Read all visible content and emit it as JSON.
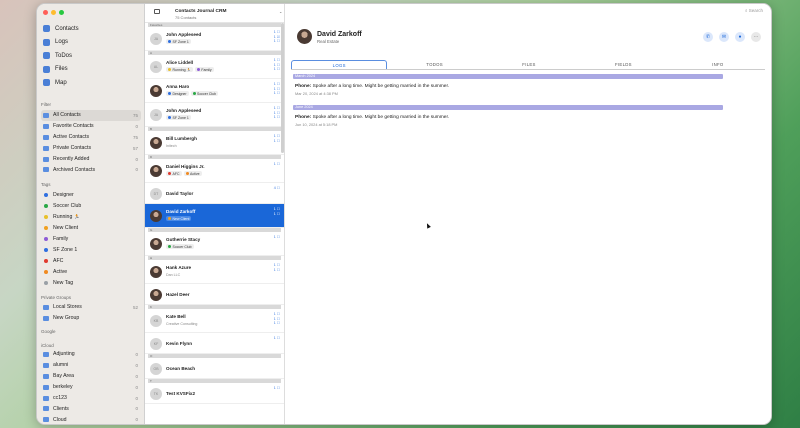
{
  "colors": {
    "accent": "#1a67d8",
    "close": "#ff5f57",
    "minimize": "#febc2e",
    "zoom": "#28c840",
    "month_bar": "#a9a8e3"
  },
  "nav": [
    {
      "label": "Contacts",
      "icon": "person-icon"
    },
    {
      "label": "Logs",
      "icon": "log-icon"
    },
    {
      "label": "ToDos",
      "icon": "todo-icon"
    },
    {
      "label": "Files",
      "icon": "folder-icon"
    },
    {
      "label": "Map",
      "icon": "map-icon"
    }
  ],
  "filter_title": "Filter",
  "filters": [
    {
      "label": "All Contacts",
      "count": "75"
    },
    {
      "label": "Favorite Contacts",
      "count": "0"
    },
    {
      "label": "Active Contacts",
      "count": "75"
    },
    {
      "label": "Private Contacts",
      "count": "57"
    },
    {
      "label": "Recently Added",
      "count": "0"
    },
    {
      "label": "Archived Contacts",
      "count": "0"
    }
  ],
  "tags_title": "Tags",
  "tags": [
    {
      "label": "Designer",
      "color": "#2f6fe0"
    },
    {
      "label": "Soccer Club",
      "color": "#2aa846"
    },
    {
      "label": "Running 🏃",
      "color": "#e8c02a"
    },
    {
      "label": "New Client",
      "color": "#f0a020"
    },
    {
      "label": "Family",
      "color": "#8d5bd6"
    },
    {
      "label": "SF Zone 1",
      "color": "#2f6fe0"
    },
    {
      "label": "AFC",
      "color": "#e03a2f"
    },
    {
      "label": "Active",
      "color": "#f08a20"
    },
    {
      "label": "New Tag",
      "color": "#9aa0a6"
    }
  ],
  "private_groups_title": "Private Groups",
  "private_groups": [
    {
      "label": "Local Stores",
      "count": "52"
    },
    {
      "label": "New Group",
      "count": ""
    }
  ],
  "google_title": "Google",
  "icloud_title": "iCloud",
  "icloud": [
    {
      "label": "Adjunting",
      "count": "0"
    },
    {
      "label": "alumni",
      "count": "0"
    },
    {
      "label": "Bay Area",
      "count": "0"
    },
    {
      "label": "berkeley",
      "count": "0"
    },
    {
      "label": "cc123",
      "count": "0"
    },
    {
      "label": "Clients",
      "count": "0"
    },
    {
      "label": "Cloud",
      "count": "0"
    }
  ],
  "list_header": {
    "title": "Contacts Journal CRM",
    "subtitle": "75 Contacts",
    "favorites_label": "Favorites"
  },
  "contacts": [
    {
      "section": "",
      "name": "John Appleseed",
      "initials": "JA",
      "photo": false,
      "sub": "",
      "tags": [
        {
          "label": "SF Zone 1",
          "color": "#2f6fe0"
        }
      ],
      "icons": "1 ☐\n1 ☑\n1 ☐"
    },
    {
      "section": "A",
      "name": "Alice Liddell",
      "initials": "AL",
      "photo": false,
      "sub": "",
      "tags": [
        {
          "label": "Running 🏃",
          "color": "#e8c02a"
        },
        {
          "label": "Family",
          "color": "#8d5bd6"
        }
      ],
      "icons": "1 ☐\n1 ☐\n1 ☐"
    },
    {
      "section": "",
      "name": "Anna Haro",
      "initials": "",
      "photo": true,
      "sub": "",
      "tags": [
        {
          "label": "Designer",
          "color": "#2f6fe0"
        },
        {
          "label": "Soccer Club",
          "color": "#2aa846"
        }
      ],
      "icons": "1 ☐\n1 ☐\n1 ☐"
    },
    {
      "section": "",
      "name": "John Appleseed",
      "initials": "JA",
      "photo": false,
      "sub": "",
      "tags": [
        {
          "label": "SF Zone 1",
          "color": "#2f6fe0"
        }
      ],
      "icons": "1 ☐\n1 ☐\n1 ☐"
    },
    {
      "section": "B",
      "name": "Bill Lumbergh",
      "initials": "",
      "photo": true,
      "sub": "Initech",
      "tags": [],
      "icons": "1 ☐\n1 ☐"
    },
    {
      "section": "D",
      "name": "Daniel Higgins Jr.",
      "initials": "",
      "photo": true,
      "sub": "",
      "tags": [
        {
          "label": "AFC",
          "color": "#e03a2f"
        },
        {
          "label": "Active",
          "color": "#f08a20"
        }
      ],
      "icons": "1 ☐"
    },
    {
      "section": "",
      "name": "David Taylor",
      "initials": "DT",
      "photo": false,
      "sub": "",
      "tags": [],
      "icons": "4 ☐"
    },
    {
      "section": "",
      "name": "David Zarkoff",
      "initials": "",
      "photo": true,
      "sub": "",
      "tags": [
        {
          "label": "New Client",
          "color": "#f0a020"
        }
      ],
      "icons": "1 ☐\n1 ☐",
      "selected": true
    },
    {
      "section": "G",
      "name": "Gutherrie Stacy",
      "initials": "",
      "photo": true,
      "sub": "",
      "tags": [
        {
          "label": "Soccer Club",
          "color": "#2aa846"
        }
      ],
      "icons": "1 ☐"
    },
    {
      "section": "H",
      "name": "Hank Azure",
      "initials": "",
      "photo": true,
      "sub": "Dan LLC",
      "tags": [],
      "icons": "1 ☐\n1 ☐"
    },
    {
      "section": "",
      "name": "Hazel Deer",
      "initials": "",
      "photo": true,
      "sub": "",
      "tags": [],
      "icons": ""
    },
    {
      "section": "K",
      "name": "Kate Bell",
      "initials": "KB",
      "photo": false,
      "sub": "Creative Consulting",
      "tags": [],
      "icons": "1 ☐\n1 ☐\n1 ☐"
    },
    {
      "section": "",
      "name": "Kevin Flynn",
      "initials": "KF",
      "photo": false,
      "sub": "",
      "tags": [],
      "icons": "1 ☐"
    },
    {
      "section": "O",
      "name": "Ocean Beach",
      "initials": "OB",
      "photo": false,
      "sub": "",
      "tags": [],
      "icons": ""
    },
    {
      "section": "T",
      "name": "Test KVSFix2",
      "initials": "TK",
      "photo": false,
      "sub": "",
      "tags": [],
      "icons": "1 ☐"
    }
  ],
  "detail": {
    "search_placeholder": "Search",
    "name": "David Zarkoff",
    "subtitle": "Real Estate",
    "tabs": [
      "LOGS",
      "TODOS",
      "FILES",
      "FIELDS",
      "INFO"
    ],
    "logs": [
      {
        "month": "March 2024",
        "label": "Phone:",
        "text": "Spoke after a long time. Might be getting married in the summer.",
        "date": "Mar 20, 2024 at 4:38 PM"
      },
      {
        "month": "June 2024",
        "label": "Phone:",
        "text": "Spoke after a long time. Might be getting married in the summer.",
        "date": "Jun 10, 2024 at 5:18 PM"
      }
    ]
  }
}
